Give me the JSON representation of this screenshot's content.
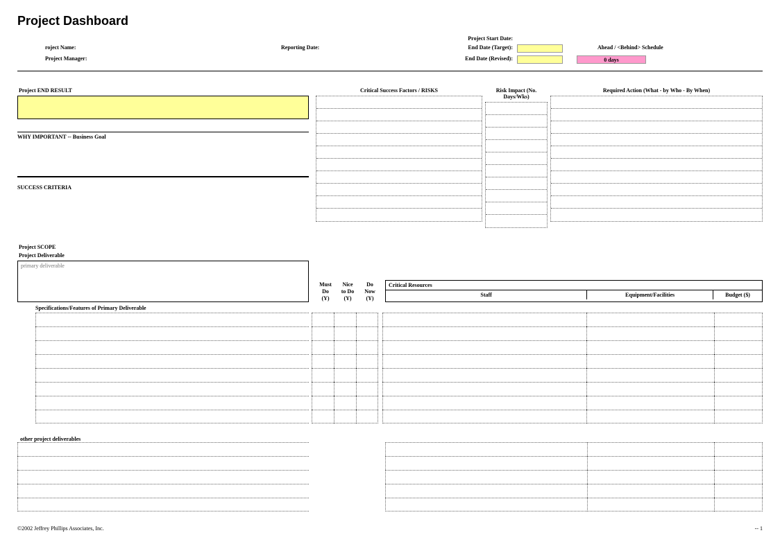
{
  "title": "Project Dashboard",
  "header": {
    "project_name_label": "roject Name:",
    "project_manager_label": "Project Manager:",
    "reporting_date_label": "Reporting Date:",
    "start_date_label": "Project Start Date:",
    "end_date_target_label": "End Date (Target):",
    "end_date_revised_label": "End Date (Revised):",
    "schedule_status_label": "Ahead / <Behind> Schedule",
    "days_value": "0 days"
  },
  "sections": {
    "end_result": "Project END RESULT",
    "csf_risks": "Critical Success Factors / RISKS",
    "risk_impact": "Risk Impact (No. Days/Wks)",
    "required_action": "Required Action  (What - by Who - By When)",
    "why_important": "WHY IMPORTANT  --  Business Goal",
    "success_criteria": "SUCCESS CRITERIA",
    "project_scope": "Project SCOPE",
    "project_deliverable": "Project Deliverable",
    "primary_deliverable_placeholder": "primary deliverable",
    "must_do": "Must Do (Y)",
    "nice_to_do": "Nice to Do (Y)",
    "do_now": "Do Now (Y)",
    "critical_resources": "Critical Resources",
    "staff": "Staff",
    "equipment": "Equipment/Facilities",
    "budget": "Budget ($)",
    "spec_features": "Specifications/Features of Primary Deliverable",
    "other_deliverables": "other project deliverables"
  },
  "footer": {
    "copyright": "©2002 Jeffrey Phillips Associates, Inc.",
    "page": "-- 1"
  }
}
